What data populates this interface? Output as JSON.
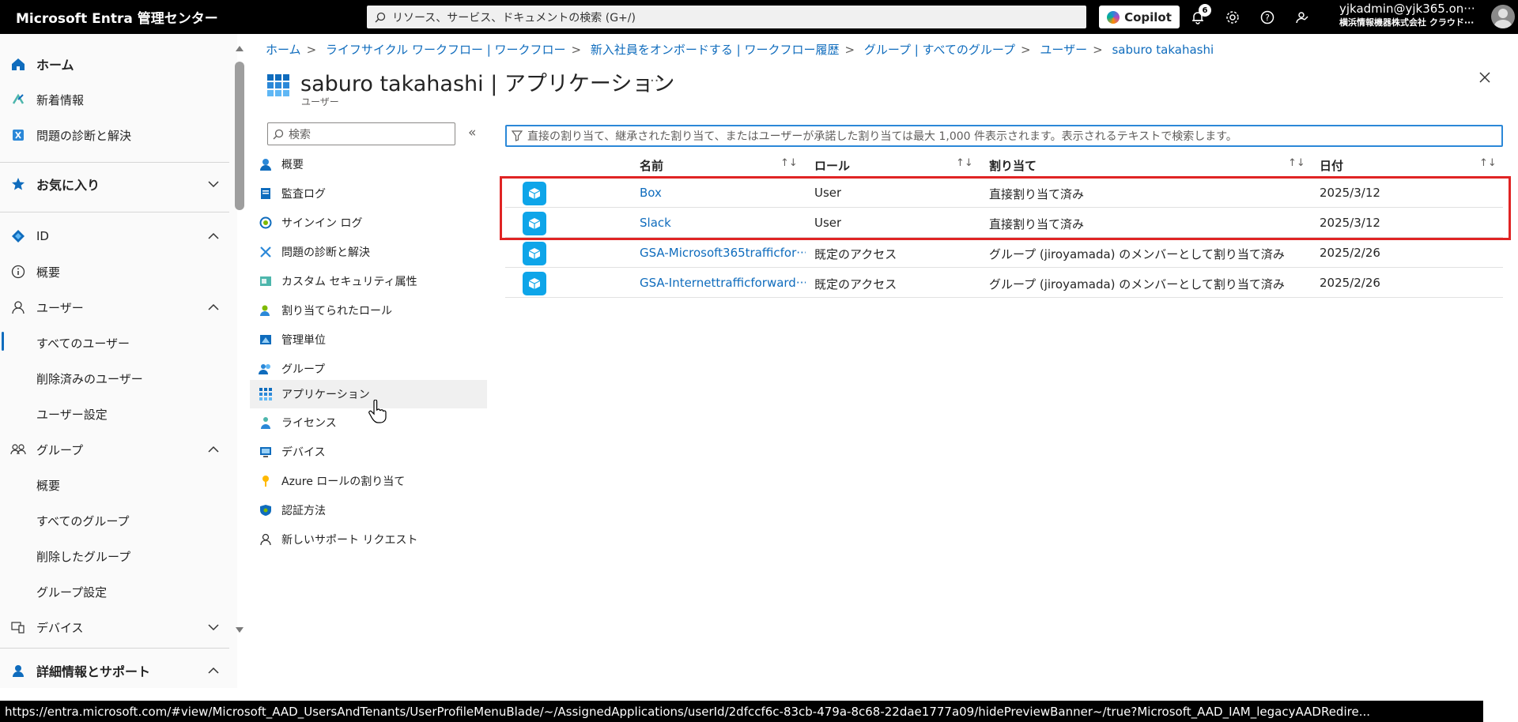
{
  "topbar": {
    "brand": "Microsoft Entra 管理センター",
    "search_placeholder": "リソース、サービス、ドキュメントの検索 (G+/)",
    "copilot_label": "Copilot",
    "notifications_count": "6",
    "account_name": "yjkadmin@yjk365.on···",
    "account_org": "横浜情報機器株式会社 クラウド···"
  },
  "leftnav": {
    "items": [
      {
        "label": "ホーム",
        "icon": "home-icon"
      },
      {
        "label": "新着情報",
        "icon": "whats-new-icon"
      },
      {
        "label": "問題の診断と解決",
        "icon": "diagnose-icon"
      },
      {
        "label": "お気に入り",
        "icon": "star-icon"
      },
      {
        "label": "ID",
        "icon": "identity-icon"
      },
      {
        "label": "概要",
        "icon": "info-icon"
      },
      {
        "label": "ユーザー",
        "icon": "user-icon"
      },
      {
        "label": "すべてのユーザー"
      },
      {
        "label": "削除済みのユーザー"
      },
      {
        "label": "ユーザー設定"
      },
      {
        "label": "グループ",
        "icon": "group-icon"
      },
      {
        "label": "概要"
      },
      {
        "label": "すべてのグループ"
      },
      {
        "label": "削除したグループ"
      },
      {
        "label": "グループ設定"
      },
      {
        "label": "デバイス",
        "icon": "device-icon"
      },
      {
        "label": "詳細情報とサポート",
        "icon": "support-icon"
      }
    ]
  },
  "breadcrumb": [
    "ホーム",
    "ライフサイクル ワークフロー | ワークフロー",
    "新入社員をオンボードする | ワークフロー履歴",
    "グループ | すべてのグループ",
    "ユーザー",
    "saburo takahashi"
  ],
  "page": {
    "title": "saburo takahashi | アプリケーション",
    "subtitle": "ユーザー",
    "more": "···"
  },
  "resource_menu": {
    "search_placeholder": "検索",
    "collapse": "«",
    "items": [
      {
        "label": "概要",
        "icon": "overview-icon"
      },
      {
        "label": "監査ログ",
        "icon": "audit-log-icon"
      },
      {
        "label": "サインイン ログ",
        "icon": "signin-log-icon"
      },
      {
        "label": "問題の診断と解決",
        "icon": "diagnose-icon"
      },
      {
        "label": "カスタム セキュリティ属性",
        "icon": "security-attr-icon"
      },
      {
        "label": "割り当てられたロール",
        "icon": "roles-icon"
      },
      {
        "label": "管理単位",
        "icon": "admin-unit-icon"
      },
      {
        "label": "グループ",
        "icon": "group-icon"
      },
      {
        "label": "アプリケーション",
        "icon": "apps-icon"
      },
      {
        "label": "ライセンス",
        "icon": "license-icon"
      },
      {
        "label": "デバイス",
        "icon": "device-icon"
      },
      {
        "label": "Azure ロールの割り当て",
        "icon": "azure-role-icon"
      },
      {
        "label": "認証方法",
        "icon": "auth-method-icon"
      },
      {
        "label": "新しいサポート リクエスト",
        "icon": "support-request-icon"
      }
    ]
  },
  "filter": {
    "placeholder": "直接の割り当て、継承された割り当て、またはユーザーが承諾した割り当ては最大 1,000 件表示されます。表示されるテキストで検索します。"
  },
  "table": {
    "columns": [
      "名前",
      "ロール",
      "割り当て",
      "日付"
    ],
    "sort_glyph": "↑↓",
    "rows": [
      {
        "name": "Box",
        "role": "User",
        "assignment": "直接割り当て済み",
        "date": "2025/3/12"
      },
      {
        "name": "Slack",
        "role": "User",
        "assignment": "直接割り当て済み",
        "date": "2025/3/12"
      },
      {
        "name": "GSA-Microsoft365trafficfor···",
        "role": "既定のアクセス",
        "assignment": "グループ (jiroyamada) のメンバーとして割り当て済み",
        "date": "2025/2/26"
      },
      {
        "name": "GSA-Internettrafficforward···",
        "role": "既定のアクセス",
        "assignment": "グループ (jiroyamada) のメンバーとして割り当て済み",
        "date": "2025/2/26"
      }
    ]
  },
  "statusbar": {
    "url": "https://entra.microsoft.com/#view/Microsoft_AAD_UsersAndTenants/UserProfileMenuBlade/~/AssignedApplications/userId/2dfccf6c-83cb-479a-8c68-22dae1777a09/hidePreviewBanner~/true?Microsoft_AAD_IAM_legacyAADRedire..."
  },
  "colors": {
    "accent": "#0f6cbd",
    "highlight": "#e02424",
    "app_icon": "#0ea5e9"
  }
}
